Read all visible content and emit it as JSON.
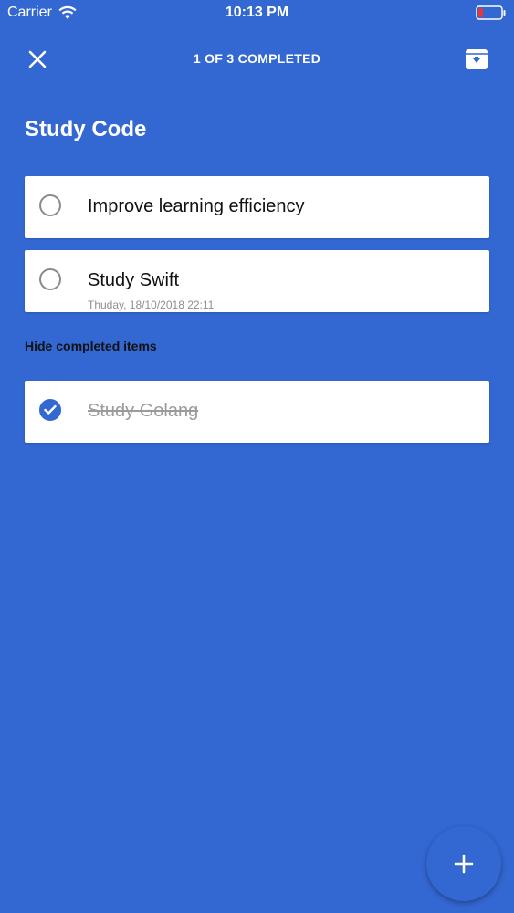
{
  "status_bar": {
    "carrier": "Carrier",
    "time": "10:13 PM"
  },
  "nav": {
    "title": "1 OF 3 COMPLETED",
    "close_icon": "close-icon",
    "archive_icon": "archive-download-icon"
  },
  "list": {
    "title": "Study Code"
  },
  "tasks": [
    {
      "label": "Improve learning efficiency",
      "date": "",
      "completed": false
    },
    {
      "label": "Study Swift",
      "date": "Thuday, 18/10/2018 22:11",
      "completed": false
    }
  ],
  "completed_section": {
    "toggle_label": "Hide completed items",
    "items": [
      {
        "label": "Study Golang",
        "completed": true
      }
    ]
  },
  "colors": {
    "background": "#3367D2",
    "card": "#ffffff",
    "text": "#111111",
    "muted": "#9b9b9b"
  },
  "fab": {
    "icon": "plus-icon"
  }
}
